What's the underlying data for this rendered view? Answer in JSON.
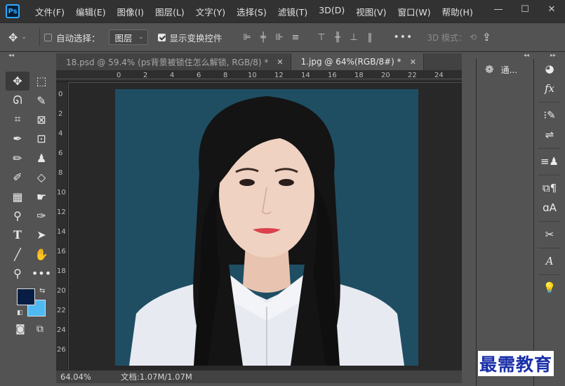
{
  "app": {
    "logo": "Ps"
  },
  "menu": [
    "文件(F)",
    "编辑(E)",
    "图像(I)",
    "图层(L)",
    "文字(Y)",
    "选择(S)",
    "滤镜(T)",
    "3D(D)",
    "视图(V)",
    "窗口(W)",
    "帮助(H)"
  ],
  "window_controls": {
    "minimize": "—",
    "restore": "☐",
    "close": "✕"
  },
  "options": {
    "auto_select_label": "自动选择：",
    "auto_select_checked": false,
    "target_value": "图层",
    "show_transform_label": "显示变换控件",
    "show_transform_checked": true,
    "more": "•••",
    "mode_3d": "3D 模式："
  },
  "tabs": [
    {
      "label": "18.psd @ 59.4% (ps背景被锁住怎么解锁, RGB/8) *",
      "close": "✕",
      "active": false
    },
    {
      "label": "1.jpg @ 64%(RGB/8#) *",
      "close": "✕",
      "active": true
    }
  ],
  "ruler": {
    "top": [
      "0",
      "2",
      "4",
      "6",
      "8",
      "10",
      "12",
      "14",
      "16",
      "18",
      "20",
      "22",
      "24"
    ],
    "left": [
      "0",
      "2",
      "4",
      "6",
      "8",
      "10",
      "12",
      "14",
      "16",
      "18",
      "20",
      "22",
      "24",
      "26"
    ]
  },
  "status": {
    "zoom": "64.04%",
    "doc": "文档:1.07M/1.07M"
  },
  "colors": {
    "foreground": "#071d44",
    "background": "#4fb9f1",
    "photo_bg": "#1f4e63"
  },
  "panels": {
    "channels_label": "通..."
  },
  "watermark": "最需教育"
}
